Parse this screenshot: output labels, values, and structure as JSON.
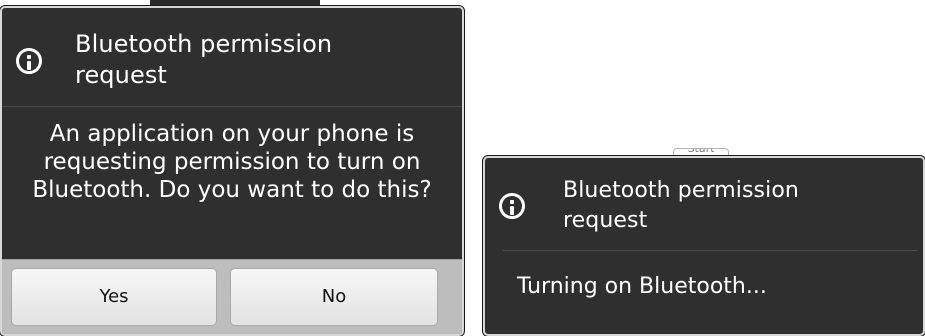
{
  "left_dialog": {
    "title": "Bluetooth permission request",
    "message": "An application on your phone is requesting permission to turn on Bluetooth. Do you want to do this?",
    "buttons": {
      "yes": "Yes",
      "no": "No"
    },
    "icon": "info-icon"
  },
  "right_dialog": {
    "title": "Bluetooth permission request",
    "status": "Turning on Bluetooth...",
    "icon": "info-icon"
  },
  "background": {
    "partial_button_label": "Start"
  },
  "colors": {
    "dialog_background": "#2f2f2f",
    "dialog_border": "#d7d7d7",
    "button_bar": "#bdbdbd",
    "button_background": "#f2f2f2",
    "text_light": "#ffffff",
    "text_dark": "#111111"
  }
}
